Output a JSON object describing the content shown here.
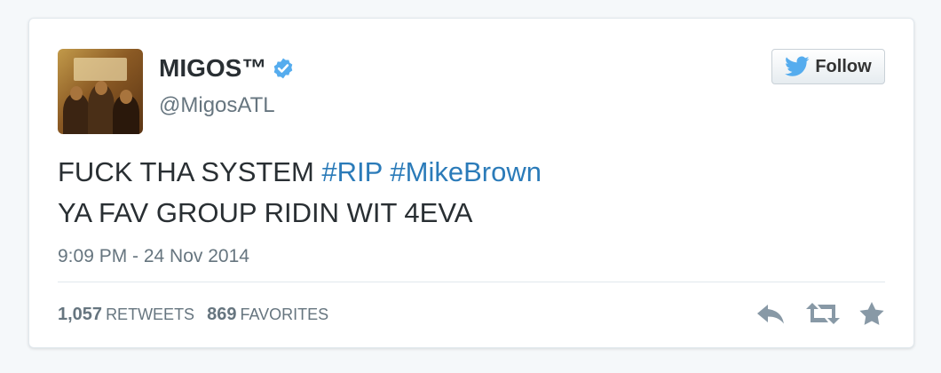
{
  "author": {
    "display_name": "MIGOS™",
    "handle": "@MigosATL",
    "verified_icon": "verified-badge-icon",
    "avatar_icon": "album-cover-avatar"
  },
  "follow_button": {
    "label": "Follow",
    "icon": "twitter-bird-icon"
  },
  "tweet": {
    "line1_text": "FUCK THA SYSTEM ",
    "hashtag1": "#RIP",
    "hashtag2": "#MikeBrown",
    "line2_text": "YA FAV GROUP RIDIN WIT 4EVA",
    "timestamp": "9:09 PM - 24 Nov 2014"
  },
  "stats": {
    "retweets_count": "1,057",
    "retweets_label": "RETWEETS",
    "favorites_count": "869",
    "favorites_label": "FAVORITES"
  },
  "actions": [
    "reply-icon",
    "retweet-icon",
    "favorite-star-icon"
  ],
  "colors": {
    "link": "#2b7bb9",
    "verified": "#55acee",
    "twitter_blue": "#55acee",
    "muted": "#66757f",
    "icon_gray": "#8899a6"
  }
}
